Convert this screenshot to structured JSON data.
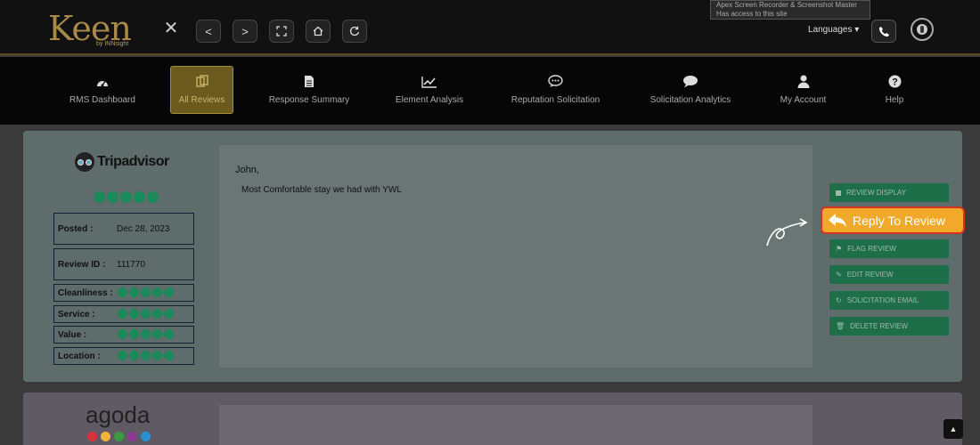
{
  "brand": {
    "logo_text": "Keen",
    "logo_sub": "by INNsight"
  },
  "extension_popup": {
    "line1": "Apex Screen Recorder & Screenshot Master",
    "line2": "Has access to this site"
  },
  "header": {
    "languages_label": "Languages"
  },
  "nav": [
    {
      "label": "RMS Dashboard",
      "icon": "dashboard-icon",
      "active": false
    },
    {
      "label": "All Reviews",
      "icon": "reviews-icon",
      "active": true
    },
    {
      "label": "Response Summary",
      "icon": "document-icon",
      "active": false
    },
    {
      "label": "Element Analysis",
      "icon": "line-chart-icon",
      "active": false
    },
    {
      "label": "Reputation Solicitation",
      "icon": "speech-bubble-icon",
      "active": false
    },
    {
      "label": "Solicitation Analytics",
      "icon": "chat-icon",
      "active": false
    },
    {
      "label": "My Account",
      "icon": "user-icon",
      "active": false
    },
    {
      "label": "Help",
      "icon": "help-icon",
      "active": false
    }
  ],
  "review": {
    "source": "Tripadvisor",
    "overall_rating": 5,
    "posted_label": "Posted :",
    "posted_value": "Dec 28, 2023",
    "review_id_label": "Review ID :",
    "review_id_value": "111770",
    "categories": [
      {
        "label": "Cleanliness :",
        "rating": 5
      },
      {
        "label": "Service :",
        "rating": 5
      },
      {
        "label": "Value :",
        "rating": 5
      },
      {
        "label": "Location :",
        "rating": 5
      }
    ],
    "reviewer_name": "John,",
    "text": "Most Comfortable stay we had with YWL"
  },
  "actions": {
    "review_display": "REVIEW DISPLAY",
    "reply": "Reply To Review",
    "flag": "FLAG REVIEW",
    "edit": "EDIT REVIEW",
    "solicitation_email": "SOLICITATION EMAIL",
    "delete": "DELETE REVIEW"
  },
  "second_review": {
    "source": "agoda",
    "logo_colors": [
      "#d8323b",
      "#f0b43c",
      "#3e9a42",
      "#8c3a95",
      "#2a8fd0"
    ]
  },
  "colors": {
    "accent_gold": "#a8894a",
    "action_green": "#1e6e4a",
    "reply_orange": "#f2a92b",
    "rating_green": "#1a8a5a"
  }
}
